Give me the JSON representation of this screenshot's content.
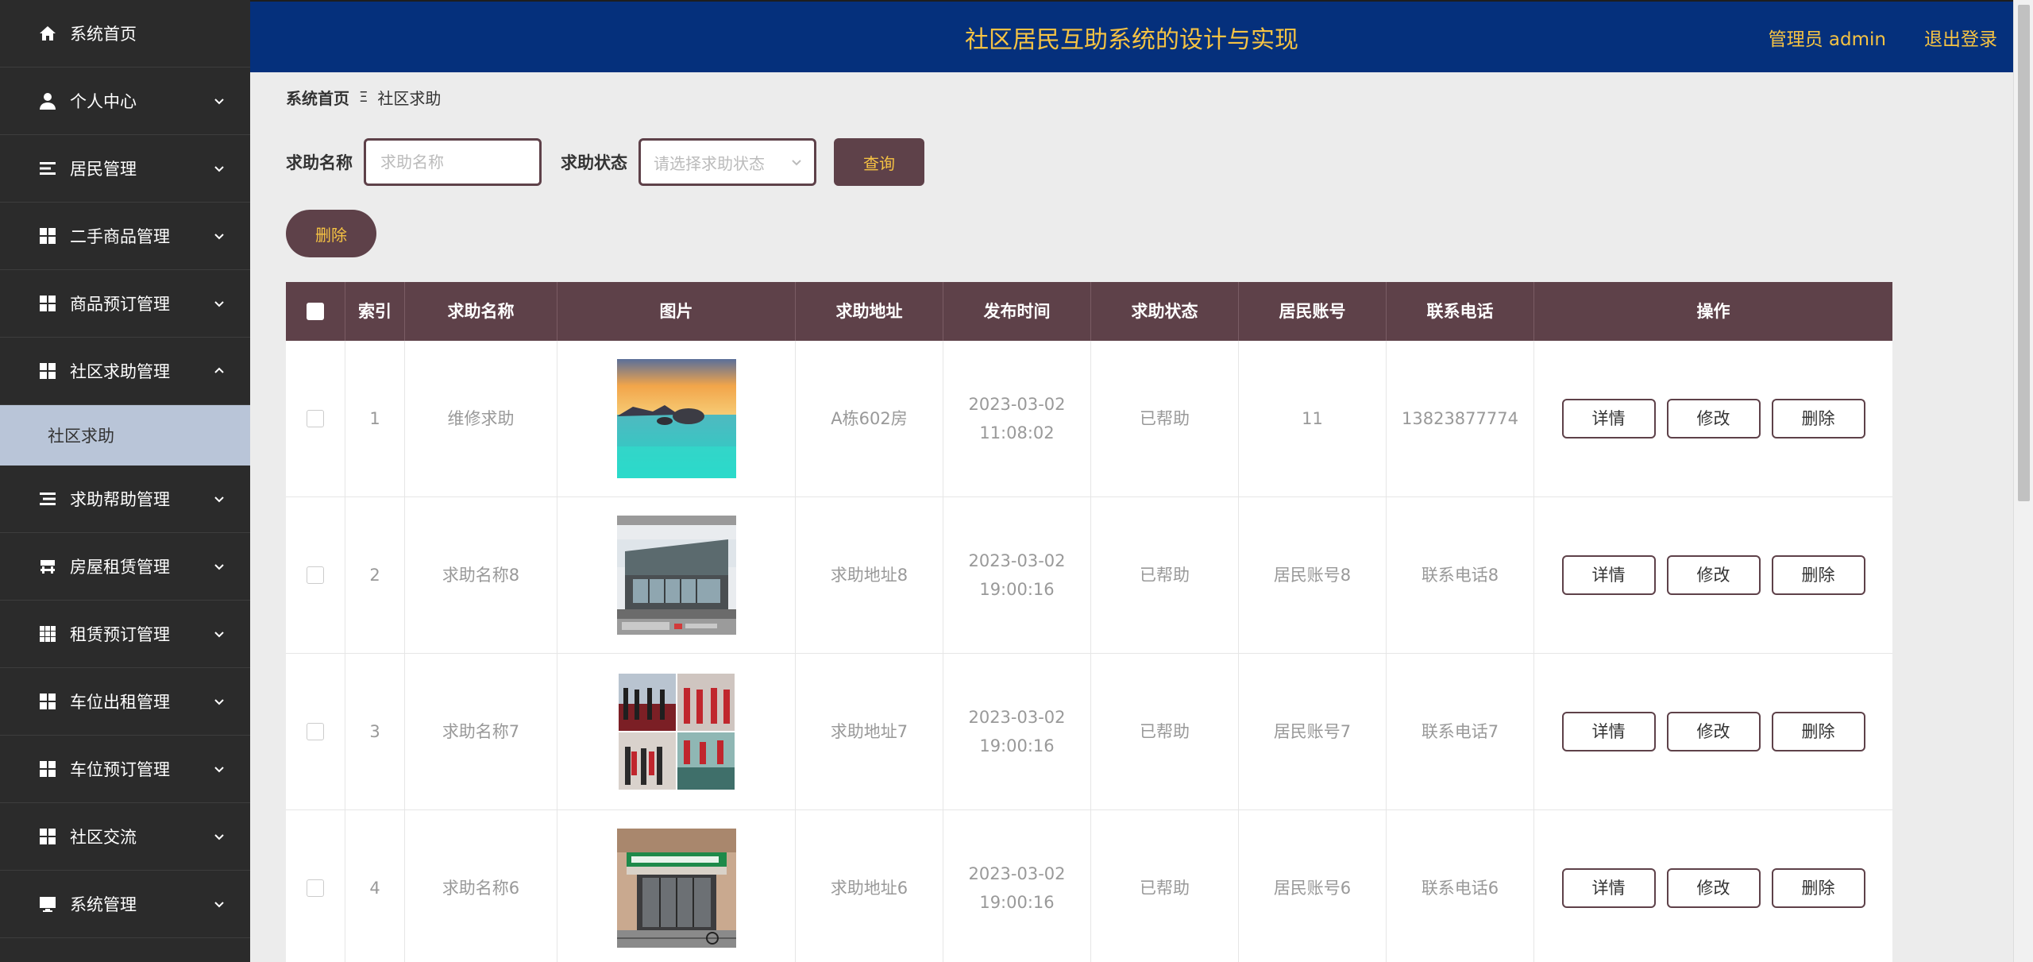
{
  "header": {
    "title": "社区居民互助系统的设计与实现",
    "admin": "管理员 admin",
    "logout": "退出登录"
  },
  "sidebar": {
    "items": [
      {
        "label": "系统首页",
        "icon": "home-icon"
      },
      {
        "label": "个人中心",
        "icon": "user-icon"
      },
      {
        "label": "居民管理",
        "icon": "list-icon"
      },
      {
        "label": "二手商品管理",
        "icon": "grid-icon"
      },
      {
        "label": "商品预订管理",
        "icon": "grid-icon"
      },
      {
        "label": "社区求助管理",
        "icon": "grid-icon"
      },
      {
        "label": "求助帮助管理",
        "icon": "list-icon"
      },
      {
        "label": "房屋租赁管理",
        "icon": "house-icon"
      },
      {
        "label": "租赁预订管理",
        "icon": "apps-icon"
      },
      {
        "label": "车位出租管理",
        "icon": "grid-icon"
      },
      {
        "label": "车位预订管理",
        "icon": "grid-icon"
      },
      {
        "label": "社区交流",
        "icon": "grid-icon"
      },
      {
        "label": "系统管理",
        "icon": "monitor-icon"
      }
    ],
    "submenu": {
      "label": "社区求助"
    }
  },
  "breadcrumb": {
    "home": "系统首页",
    "separator": "Ξ",
    "current": "社区求助"
  },
  "search": {
    "name_label": "求助名称",
    "name_placeholder": "求助名称",
    "status_label": "求助状态",
    "status_placeholder": "请选择求助状态",
    "query_button": "查询"
  },
  "batch_delete_button": "删除",
  "table": {
    "headers": [
      "索引",
      "求助名称",
      "图片",
      "求助地址",
      "发布时间",
      "求助状态",
      "居民账号",
      "联系电话",
      "操作"
    ],
    "ops": {
      "detail": "详情",
      "edit": "修改",
      "delete": "删除"
    },
    "rows": [
      {
        "index": "1",
        "name": "维修求助",
        "address": "A栋602房",
        "time": "2023-03-02 11:08:02",
        "status": "已帮助",
        "account": "11",
        "phone": "13823877774"
      },
      {
        "index": "2",
        "name": "求助名称8",
        "address": "求助地址8",
        "time": "2023-03-02 19:00:16",
        "status": "已帮助",
        "account": "居民账号8",
        "phone": "联系电话8"
      },
      {
        "index": "3",
        "name": "求助名称7",
        "address": "求助地址7",
        "time": "2023-03-02 19:00:16",
        "status": "已帮助",
        "account": "居民账号7",
        "phone": "联系电话7"
      },
      {
        "index": "4",
        "name": "求助名称6",
        "address": "求助地址6",
        "time": "2023-03-02 19:00:16",
        "status": "已帮助",
        "account": "居民账号6",
        "phone": "联系电话6"
      }
    ]
  }
}
